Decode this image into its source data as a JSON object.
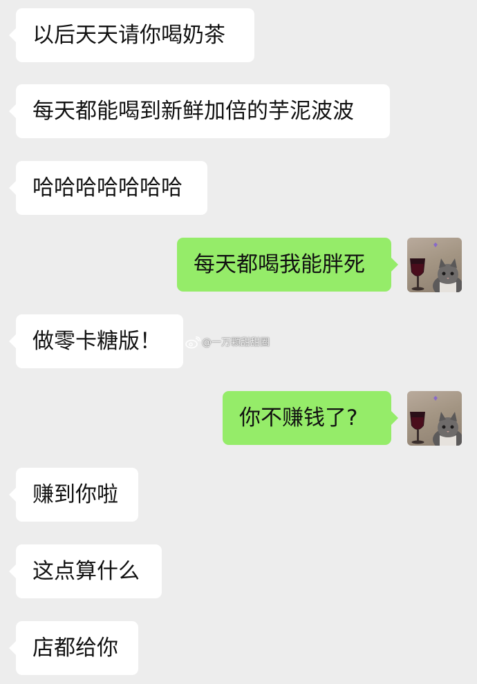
{
  "messages": [
    {
      "side": "in",
      "text": "以后天天请你喝奶茶"
    },
    {
      "side": "in",
      "text": "每天都能喝到新鲜加倍的芋泥波波"
    },
    {
      "side": "in",
      "text": "哈哈哈哈哈哈哈"
    },
    {
      "side": "out",
      "text": "每天都喝我能胖死"
    },
    {
      "side": "in",
      "text": "做零卡糖版！"
    },
    {
      "side": "out",
      "text": "你不赚钱了?"
    },
    {
      "side": "in",
      "text": "赚到你啦"
    },
    {
      "side": "in",
      "text": "这点算什么"
    },
    {
      "side": "in",
      "text": "店都给你"
    }
  ],
  "watermark": {
    "handle": "@一万颗甜甜圈",
    "icon": "weibo-logo"
  },
  "avatar": {
    "icon": "cat-with-wine-glass-avatar"
  },
  "colors": {
    "background": "#ededed",
    "incoming_bubble": "#ffffff",
    "outgoing_bubble": "#95ec69",
    "text": "#111111"
  }
}
